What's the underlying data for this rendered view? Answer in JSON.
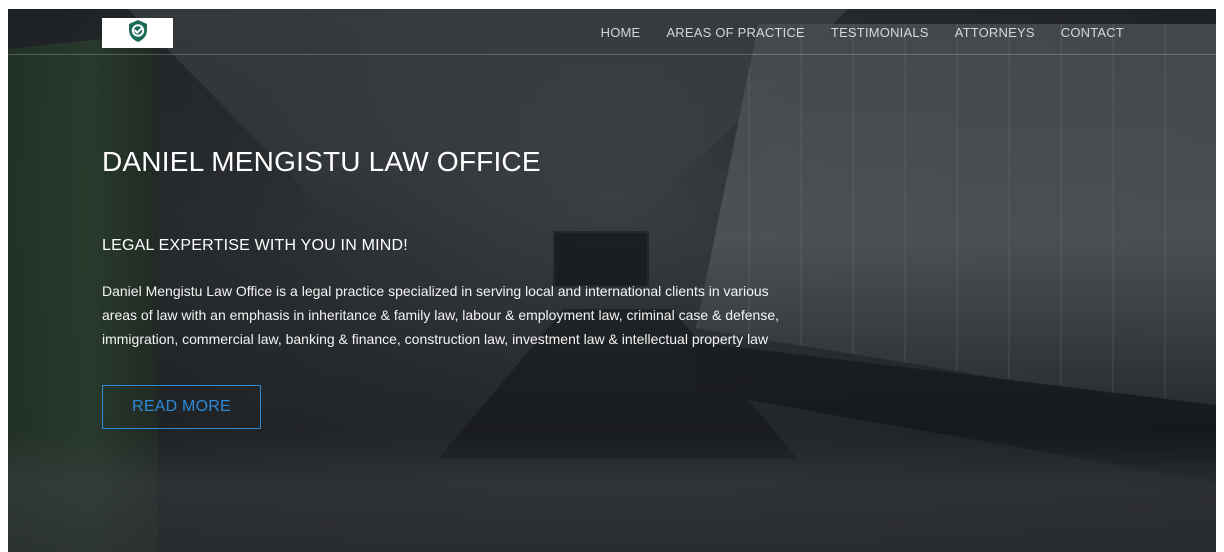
{
  "nav": {
    "items": [
      "HOME",
      "AREAS OF PRACTICE",
      "TESTIMONIALS",
      "ATTORNEYS",
      "CONTACT"
    ]
  },
  "hero": {
    "title": "DANIEL MENGISTU LAW OFFICE",
    "tagline": "LEGAL EXPERTISE WITH YOU IN MIND!",
    "description": "Daniel Mengistu Law Office is a legal practice specialized in serving local and international clients in various areas of law with an emphasis in inheritance & family law, labour & employment law, criminal case & defense, immigration, commercial law, banking & finance, construction law, investment law & intellectual property law",
    "cta_label": "READ MORE"
  },
  "colors": {
    "accent": "#2e8bd8",
    "logo_green": "#1b6a56",
    "overlay": "#14161a"
  },
  "icons": {
    "logo": "shield-badge-icon"
  }
}
